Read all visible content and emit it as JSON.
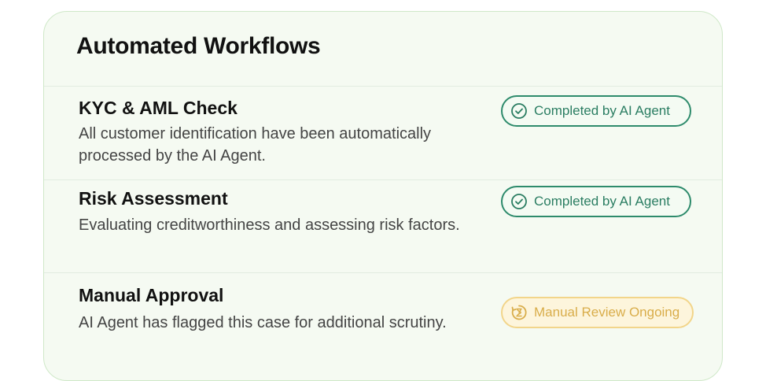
{
  "card": {
    "title": "Automated Workflows"
  },
  "workflows": [
    {
      "title": "KYC & AML Check",
      "description": "All customer identification have been automatically processed by the AI Agent.",
      "status_label": "Completed by AI Agent",
      "status_icon": "check-circle-icon",
      "status_color": "#2e8b6c"
    },
    {
      "title": "Risk Assessment",
      "description": "Evaluating creditworthiness and assessing risk factors.",
      "status_label": "Completed by AI Agent",
      "status_icon": "check-circle-icon",
      "status_color": "#2e8b6c"
    },
    {
      "title": "Manual Approval",
      "description": "AI Agent has flagged this case for additional scrutiny.",
      "status_label": "Manual Review Ongoing",
      "status_icon": "hourglass-refresh-icon",
      "status_color": "#e0b24a"
    }
  ]
}
